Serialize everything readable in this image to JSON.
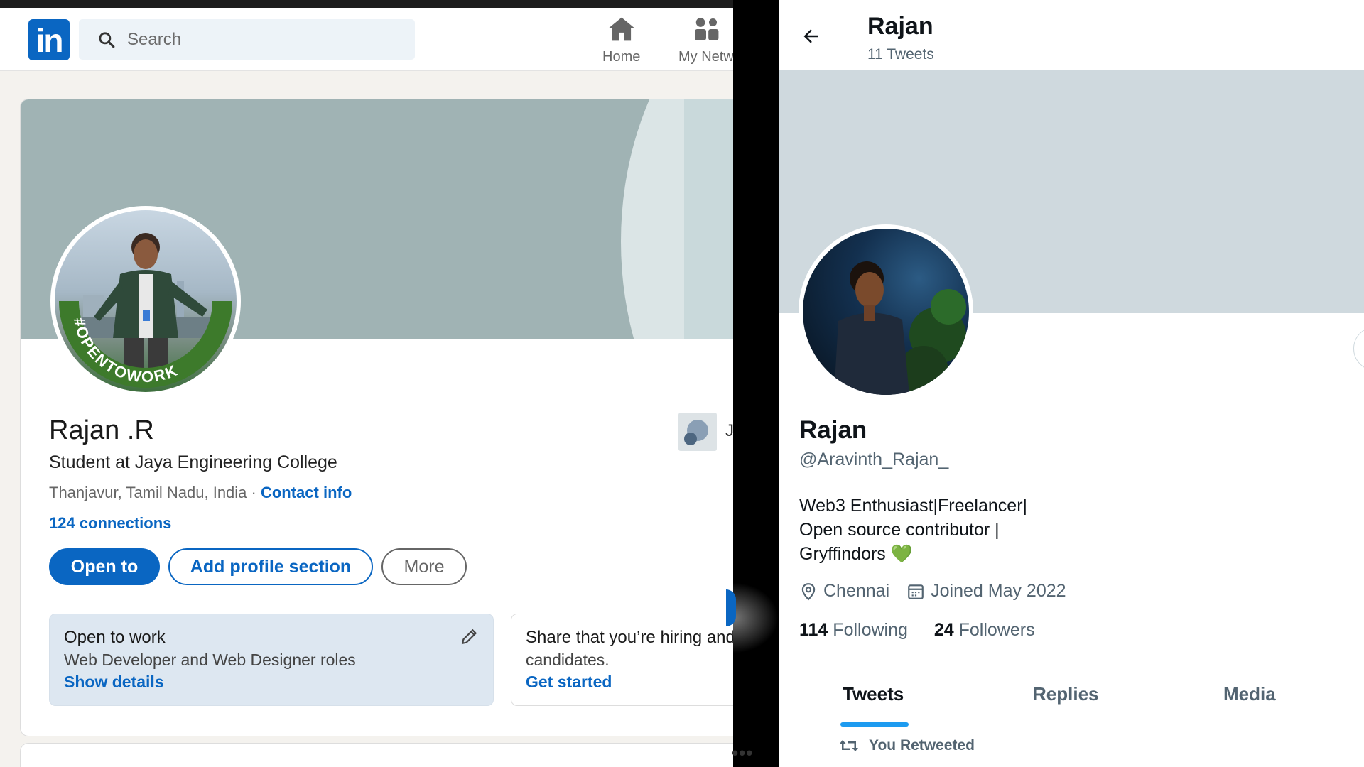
{
  "linkedin": {
    "logo": "in",
    "search": {
      "placeholder": "Search"
    },
    "nav": [
      {
        "label": "Home",
        "icon": "home-icon"
      },
      {
        "label": "My Netw",
        "icon": "network-icon"
      }
    ],
    "profile": {
      "avatar_badge": "#OPENTOWORK",
      "name": "Rajan .R",
      "headline": "Student at Jaya Engineering College",
      "location": "Thanjavur, Tamil Nadu, India · ",
      "contact_link": "Contact info",
      "connections": "124 connections",
      "experience_org_initial": "J",
      "buttons": {
        "open_to": "Open to",
        "add_section": "Add profile section",
        "more": "More"
      },
      "open_to_work": {
        "title": "Open to work",
        "roles": "Web Developer and Web Designer roles",
        "link": "Show details"
      },
      "hiring": {
        "title": "Share that you’re hiring and",
        "subtitle": "candidates.",
        "link": "Get started"
      }
    },
    "overflow": "•••",
    "colors": {
      "brand": "#0a66c2",
      "banner": "#a0b3b4",
      "open_to_work_green": "#3d7a2b"
    }
  },
  "twitter": {
    "header": {
      "title": "Rajan",
      "subtitle": "11 Tweets"
    },
    "profile": {
      "name": "Rajan",
      "handle": "@Aravinth_Rajan_",
      "bio_lines": [
        "Web3 Enthusiast|Freelancer|",
        "Open source contributor |",
        "Gryffindors"
      ],
      "bio_emoji": "💚",
      "location": "Chennai",
      "joined": "Joined May 2022",
      "following_count": "114",
      "following_label": "Following",
      "followers_count": "24",
      "followers_label": "Followers"
    },
    "tabs": [
      "Tweets",
      "Replies",
      "Media"
    ],
    "active_tab": "Tweets",
    "retweet_label": "You Retweeted",
    "colors": {
      "accent": "#1d9bf0",
      "banner": "#cfd9de"
    }
  }
}
